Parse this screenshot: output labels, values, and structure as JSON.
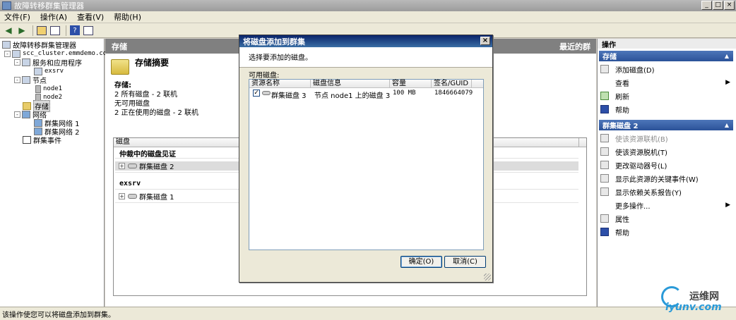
{
  "window": {
    "title": "故障转移群集管理器"
  },
  "menu": [
    "文件(F)",
    "操作(A)",
    "查看(V)",
    "帮助(H)"
  ],
  "tree": {
    "root": "故障转移群集管理器",
    "cluster": "scc_cluster.emmdemo.com",
    "services": "服务和应用程序",
    "exsrv": "exsrv",
    "nodes": "节点",
    "node1": "node1",
    "node2": "node2",
    "storage": "存储",
    "networks": "网络",
    "net1": "群集网络 1",
    "net2": "群集网络 2",
    "events": "群集事件"
  },
  "center": {
    "header": "存储",
    "header_right": "最近的群",
    "summary_title": "存储摘要",
    "label_storage": "存储:",
    "line1": "2 所有磁盘 - 2 联机",
    "line2": "无可用磁盘",
    "line3": "2 正在使用的磁盘 - 2 联机",
    "table_header": "磁盘",
    "group1": "仲裁中的磁盘见证",
    "disk2": "群集磁盘 2",
    "group2": "exsrv",
    "disk1": "群集磁盘 1"
  },
  "actions": {
    "title": "操作",
    "sec1": "存储",
    "add_disk": "添加磁盘(D)",
    "view": "查看",
    "refresh": "刷新",
    "help": "帮助",
    "sec2": "群集磁盘 2",
    "bring_online": "使该资源联机(B)",
    "take_offline": "使该资源脱机(T)",
    "change_drive": "更改驱动器号(L)",
    "critical_events": "显示此资源的关键事件(W)",
    "dependency_report": "显示依赖关系报告(Y)",
    "more_actions": "更多操作...",
    "properties": "属性",
    "help2": "帮助"
  },
  "dialog": {
    "title": "将磁盘添加到群集",
    "prompt": "选择要添加的磁盘。",
    "available_label": "可用磁盘:",
    "columns": [
      "资源名称",
      "磁盘信息",
      "容量",
      "签名/GUID"
    ],
    "row": {
      "name": "群集磁盘 3",
      "info": "节点 node1 上的磁盘 3",
      "capacity": "100 MB",
      "signature": "1846664079"
    },
    "ok": "确定(O)",
    "cancel": "取消(C)"
  },
  "status": "该操作使您可以将磁盘添加到群集。",
  "watermark": {
    "cn": "运维网",
    "en": "iyunv.com"
  }
}
